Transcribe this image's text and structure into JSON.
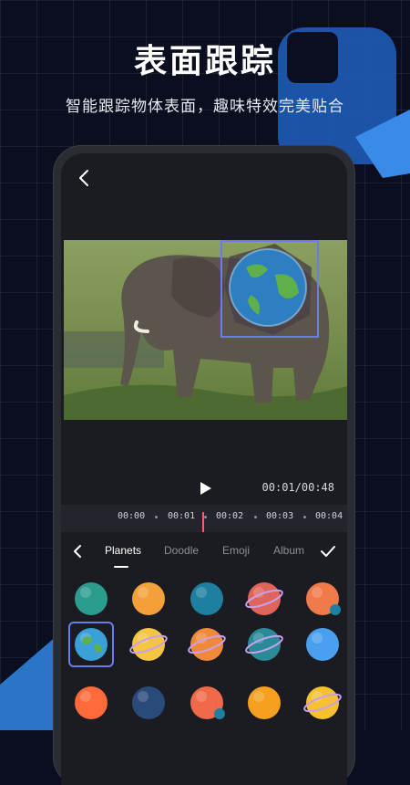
{
  "headline": "表面跟踪",
  "subheadline": "智能跟踪物体表面，趣味特效完美贴合",
  "player": {
    "timecode": "00:01/00:48"
  },
  "timeline": {
    "ticks": [
      "00:00",
      "00:01",
      "00:02",
      "00:03",
      "00:04"
    ]
  },
  "sticker_tabs": {
    "items": [
      "Planets",
      "Doodle",
      "Emoji",
      "Album"
    ],
    "active": "Planets"
  },
  "stickers": [
    {
      "name": "teal-planet",
      "color": "#2a9d8f"
    },
    {
      "name": "orange-planet",
      "color": "#f3a03a"
    },
    {
      "name": "blue-teal-planet",
      "color": "#1f7fa0"
    },
    {
      "name": "red-ringed-planet",
      "color": "#e0645a"
    },
    {
      "name": "orange-moon-planet",
      "color": "#f07a4a"
    },
    {
      "name": "earth-planet",
      "color": "#3aa0d8",
      "selected": true
    },
    {
      "name": "yellow-ringed-planet",
      "color": "#f4c542"
    },
    {
      "name": "orange-ringed-planet",
      "color": "#f08a3a"
    },
    {
      "name": "teal-ringed-planet",
      "color": "#2a8a96"
    },
    {
      "name": "blue-planet",
      "color": "#4aa0f0"
    },
    {
      "name": "sun-comet",
      "color": "#ff6a3a"
    },
    {
      "name": "navy-planet",
      "color": "#2a4a7a"
    },
    {
      "name": "coral-moon-planet",
      "color": "#f06a4a"
    },
    {
      "name": "sun",
      "color": "#f5a020"
    },
    {
      "name": "gold-ringed-planet",
      "color": "#f6c030"
    }
  ],
  "colors": {
    "accent": "#6c7cf0",
    "playhead": "#ff5c6c",
    "deco_blue": "#2f7fd8"
  },
  "icons": {
    "back": "chevron-left-icon",
    "play": "play-icon",
    "confirm": "check-icon"
  }
}
